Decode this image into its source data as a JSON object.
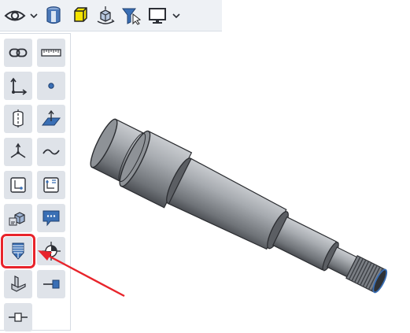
{
  "toolbar": {
    "items": [
      {
        "name": "eye-icon",
        "kind": "view"
      },
      {
        "name": "chevron-down-icon",
        "kind": "dropdown"
      },
      {
        "name": "cylinder-icon",
        "kind": "display"
      },
      {
        "name": "cube-icon",
        "kind": "display"
      },
      {
        "name": "rotate-part-icon",
        "kind": "display"
      },
      {
        "name": "filter-icon",
        "kind": "selection"
      },
      {
        "name": "monitor-icon",
        "kind": "settings"
      },
      {
        "name": "chevron-down-icon",
        "kind": "dropdown"
      }
    ]
  },
  "palette": {
    "tools": [
      {
        "name": "link-icon"
      },
      {
        "name": "ruler-icon"
      },
      {
        "name": "coordinate-axes-2d-icon"
      },
      {
        "name": "point-icon"
      },
      {
        "name": "cylinder-axis-icon"
      },
      {
        "name": "plane-icon"
      },
      {
        "name": "coordinate-axes-3d-icon"
      },
      {
        "name": "curve-icon"
      },
      {
        "name": "sketch-point-icon"
      },
      {
        "name": "sketch-3d-icon"
      },
      {
        "name": "mass-properties-icon"
      },
      {
        "name": "comment-icon"
      },
      {
        "name": "thread-feature-icon",
        "highlighted": true
      },
      {
        "name": "center-of-mass-icon"
      },
      {
        "name": "bracket-part-icon"
      },
      {
        "name": "connector-right-icon"
      },
      {
        "name": "connector-inline-icon"
      }
    ]
  },
  "colors": {
    "highlight": "#e8242b",
    "arrow": "#e8242b",
    "toolbar_bg": "#eef1f5",
    "cell_bg": "#dfe3e9",
    "accent_blue": "#3a6fb5",
    "accent_yellow": "#f5e400"
  },
  "viewport": {
    "model": "stepped-shaft-with-threaded-end"
  }
}
